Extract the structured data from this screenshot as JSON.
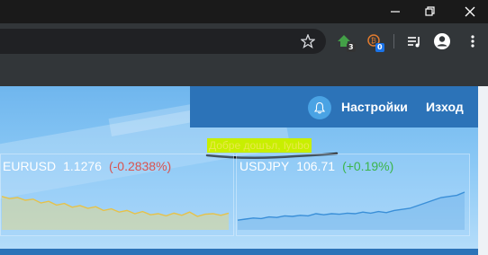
{
  "browser": {
    "toolbar_icons": [
      "star-icon",
      "home-extension-icon",
      "bitcoin-extension-icon",
      "media-playlist-icon",
      "account-icon",
      "menu-icon"
    ],
    "home_badge": "3",
    "bitcoin_badge": "0"
  },
  "header": {
    "settings_label": "Настройки",
    "logout_label": "Изход"
  },
  "welcome": {
    "text": "Добре дошъл,  lyubo"
  },
  "tickers": [
    {
      "symbol": "EURUSD",
      "price": "1.1276",
      "change": "(-0.2838%)",
      "trend": "down",
      "sparkline": [
        0.62,
        0.58,
        0.6,
        0.55,
        0.57,
        0.5,
        0.53,
        0.46,
        0.49,
        0.42,
        0.45,
        0.4,
        0.43,
        0.36,
        0.39,
        0.33,
        0.36,
        0.3,
        0.34,
        0.28,
        0.3,
        0.26,
        0.31,
        0.27,
        0.33,
        0.25,
        0.29,
        0.3,
        0.27,
        0.31
      ]
    },
    {
      "symbol": "USDJPY",
      "price": "106.71",
      "change": "(+0.19%)",
      "trend": "up",
      "sparkline": [
        0.18,
        0.2,
        0.22,
        0.21,
        0.24,
        0.23,
        0.26,
        0.25,
        0.27,
        0.26,
        0.3,
        0.28,
        0.3,
        0.29,
        0.31,
        0.3,
        0.33,
        0.31,
        0.34,
        0.32,
        0.36,
        0.38,
        0.4,
        0.45,
        0.5,
        0.55,
        0.6,
        0.62,
        0.64,
        0.7
      ]
    }
  ],
  "colors": {
    "header_bg": "#2c73b8",
    "welcome_highlight": "#c8ef00",
    "negative": "#d9534f",
    "positive": "#3cb54a"
  }
}
